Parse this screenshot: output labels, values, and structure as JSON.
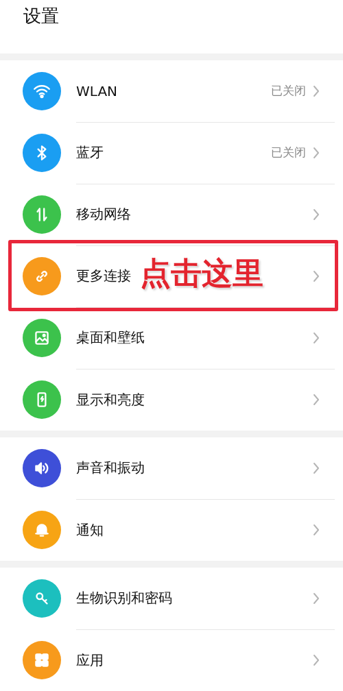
{
  "title": "设置",
  "groups": [
    {
      "items": [
        {
          "kind": "wifi",
          "label": "WLAN",
          "value": "已关闭",
          "color": "#1a9ef2"
        },
        {
          "kind": "bluetooth",
          "label": "蓝牙",
          "value": "已关闭",
          "color": "#1a9ef2"
        },
        {
          "kind": "mobile",
          "label": "移动网络",
          "color": "#3cc24c"
        },
        {
          "kind": "link",
          "label": "更多连接",
          "color": "#f79a1c",
          "callout": "点击这里"
        },
        {
          "kind": "image",
          "label": "桌面和壁纸",
          "color": "#3cc24c"
        },
        {
          "kind": "phone",
          "label": "显示和亮度",
          "color": "#3cc24c"
        }
      ]
    },
    {
      "items": [
        {
          "kind": "sound",
          "label": "声音和振动",
          "color": "#3e4fd8"
        },
        {
          "kind": "bell",
          "label": "通知",
          "color": "#f7a414"
        }
      ]
    },
    {
      "items": [
        {
          "kind": "key",
          "label": "生物识别和密码",
          "color": "#1cbfbe"
        },
        {
          "kind": "apps",
          "label": "应用",
          "color": "#f79a1c"
        }
      ]
    }
  ]
}
